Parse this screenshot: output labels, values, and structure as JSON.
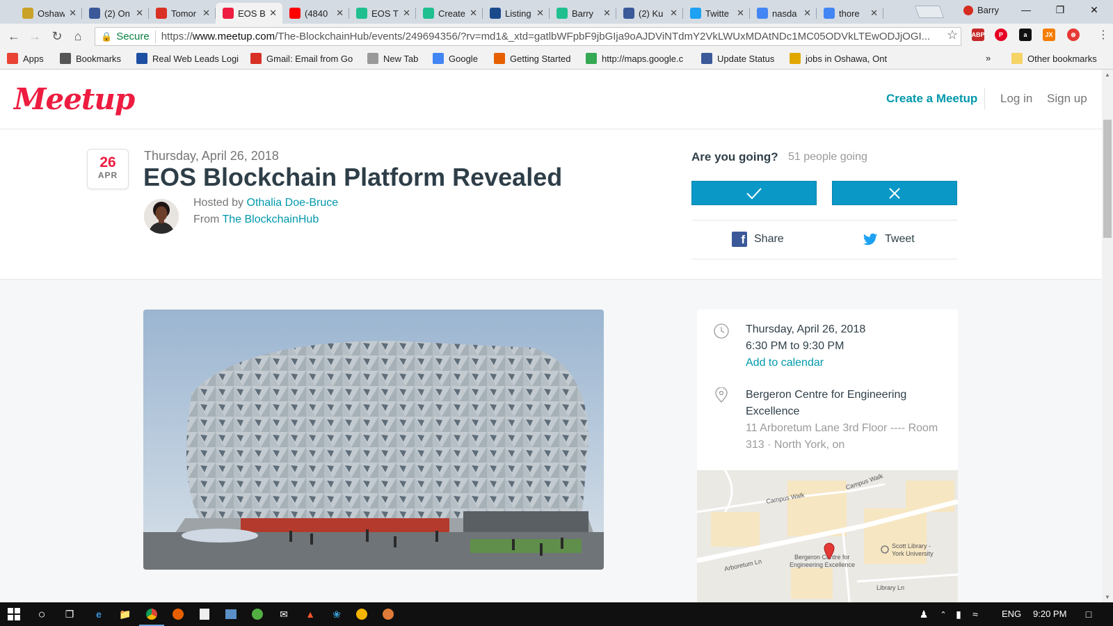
{
  "browser": {
    "tabs": [
      {
        "title": "Oshaw",
        "icon": "oshawa-favicon-icon",
        "color": "#c9a227"
      },
      {
        "title": "(2) On",
        "icon": "facebook-icon",
        "color": "#3b5998"
      },
      {
        "title": "Tomor",
        "icon": "gmail-icon",
        "color": "#d93025"
      },
      {
        "title": "EOS B",
        "icon": "meetup-icon",
        "color": "#ed1c40",
        "active": true
      },
      {
        "title": "(4840",
        "icon": "youtube-icon",
        "color": "#ff0000"
      },
      {
        "title": "EOS T",
        "icon": "steemit-icon",
        "color": "#1fbf8f"
      },
      {
        "title": "Create",
        "icon": "steemit-icon",
        "color": "#1fbf8f"
      },
      {
        "title": "Listing",
        "icon": "nasdaq-icon",
        "color": "#1a4a8c"
      },
      {
        "title": "Barry",
        "icon": "steemit-icon",
        "color": "#1fbf8f"
      },
      {
        "title": "(2) Ku",
        "icon": "facebook-icon",
        "color": "#3b5998"
      },
      {
        "title": "Twitte",
        "icon": "twitter-icon",
        "color": "#1da1f2"
      },
      {
        "title": "nasda",
        "icon": "google-icon",
        "color": "#4285f4"
      },
      {
        "title": "thore",
        "icon": "google-icon",
        "color": "#4285f4"
      }
    ],
    "user": "Barry",
    "omnibox": {
      "secure_label": "Secure",
      "url_scheme": "https://",
      "url_host": "www.meetup.com",
      "url_rest": "/The-BlockchainHub/events/249694356/?rv=md1&_xtd=gatlbWFpbF9jbGIja9oAJDViNTdmY2VkLWUxMDAtNDc1MC05ODVkLTEwODJjOGI..."
    },
    "extensions": [
      "ABP",
      "P",
      "a",
      "JX",
      "⊗"
    ],
    "bookmarks": [
      {
        "label": "Apps",
        "icon": "apps-grid-icon"
      },
      {
        "label": "Bookmarks",
        "icon": "star-icon"
      },
      {
        "label": "Real Web Leads Logi",
        "icon": "leads-icon"
      },
      {
        "label": "Gmail: Email from Go",
        "icon": "gmail-icon"
      },
      {
        "label": "New Tab",
        "icon": "page-icon"
      },
      {
        "label": "Google",
        "icon": "google-icon"
      },
      {
        "label": "Getting Started",
        "icon": "firefox-icon"
      },
      {
        "label": "http://maps.google.c",
        "icon": "maps-icon"
      },
      {
        "label": "Update Status",
        "icon": "facebook-icon"
      },
      {
        "label": "jobs in Oshawa, Ont",
        "icon": "ie-icon"
      }
    ],
    "bookmarks_overflow": "»",
    "other_bookmarks": "Other bookmarks"
  },
  "site": {
    "logo": "Meetup",
    "nav": {
      "create": "Create a Meetup",
      "login": "Log in",
      "signup": "Sign up"
    }
  },
  "event": {
    "date_day": "26",
    "date_month": "APR",
    "date_full": "Thursday, April 26, 2018",
    "title": "EOS Blockchain Platform Revealed",
    "hosted_by_prefix": "Hosted by",
    "host_name": "Othalia Doe-Bruce",
    "from_prefix": "From",
    "group_name": "The BlockchainHub",
    "going_question": "Are you going?",
    "going_count": "51 people going",
    "share_label": "Share",
    "tweet_label": "Tweet",
    "when_date": "Thursday, April 26, 2018",
    "when_time": "6:30 PM to 9:30 PM",
    "add_to_calendar": "Add to calendar",
    "venue_name_1": "Bergeron Centre for Engineering",
    "venue_name_2": "Excellence",
    "venue_address_1": "11 Arboretum Lane 3rd Floor ---- Room",
    "venue_address_2": "313 · North York, on",
    "map_labels": {
      "campus_walk_1": "Campus Walk",
      "campus_walk_2": "Campus Walk",
      "arboretum": "Arboretum Ln",
      "library": "Library Ln",
      "marker_1": "Bergeron Centre for",
      "marker_2": "Engineering Excellence",
      "scott_1": "Scott Library -",
      "scott_2": "York University"
    }
  },
  "taskbar": {
    "lang": "ENG",
    "time": "9:20 PM"
  },
  "colors": {
    "meetup_red": "#ed1c40",
    "meetup_teal": "#0098ab",
    "rsvp_blue": "#0a98c7"
  }
}
